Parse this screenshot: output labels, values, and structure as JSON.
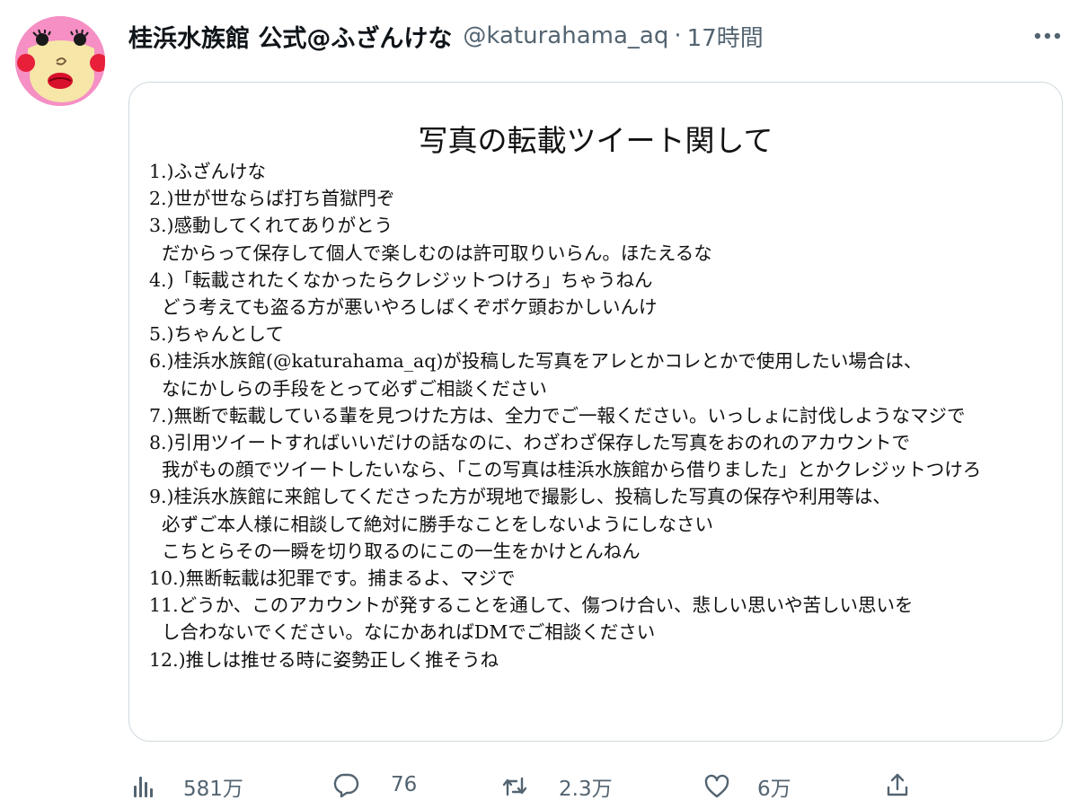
{
  "tweet": {
    "display_name": "桂浜水族館 公式@ふざんけな",
    "handle": "@katurahama_aq",
    "separator": "·",
    "time": "17時間",
    "more_icon": "more-icon"
  },
  "image_card": {
    "title": "写真の転載ツイート関して",
    "lines": [
      "1.)ふざんけな",
      "2.)世が世ならば打ち首獄門ぞ",
      "3.)感動してくれてありがとう",
      "だからって保存して個人で楽しむのは許可取りいらん。ほたえるな",
      "4.)「転載されたくなかったらクレジットつけろ」ちゃうねん",
      "どう考えても盗る方が悪いやろしばくぞボケ頭おかしいんけ",
      "5.)ちゃんとして",
      "6.)桂浜水族館(@katurahama_aq)が投稿した写真をアレとかコレとかで使用したい場合は、",
      "なにかしらの手段をとって必ずご相談ください",
      "7.)無断で転載している輩を見つけた方は、全力でご一報ください。いっしょに討伐しようなマジで",
      "8.)引用ツイートすればいいだけの話なのに、わざわざ保存した写真をおのれのアカウントで",
      "我がもの顔でツイートしたいなら、「この写真は桂浜水族館から借りました」とかクレジットつけろ",
      "9.)桂浜水族館に来館してくださった方が現地で撮影し、投稿した写真の保存や利用等は、",
      "必ずご本人様に相談して絶対に勝手なことをしないようにしなさい",
      "こちとらその一瞬を切り取るのにこの一生をかけとんねん",
      "10.)無断転載は犯罪です。捕まるよ、マジで",
      "11.どうか、このアカウントが発することを通して、傷つけ合い、悲しい思いや苦しい思いを",
      "し合わないでください。なにかあればDMでご相談ください",
      "12.)推しは推せる時に姿勢正しく推そうね"
    ]
  },
  "actions": {
    "views": {
      "icon": "views-icon",
      "count": "581万"
    },
    "reply": {
      "icon": "reply-icon",
      "count": "76"
    },
    "retweet": {
      "icon": "retweet-icon",
      "count": "2.3万"
    },
    "like": {
      "icon": "like-icon",
      "count": "6万"
    },
    "share": {
      "icon": "share-icon"
    }
  },
  "colors": {
    "text_primary": "#0f1419",
    "text_secondary": "#536471",
    "border": "#cfd9de",
    "avatar_bg": "#f58fc4"
  }
}
